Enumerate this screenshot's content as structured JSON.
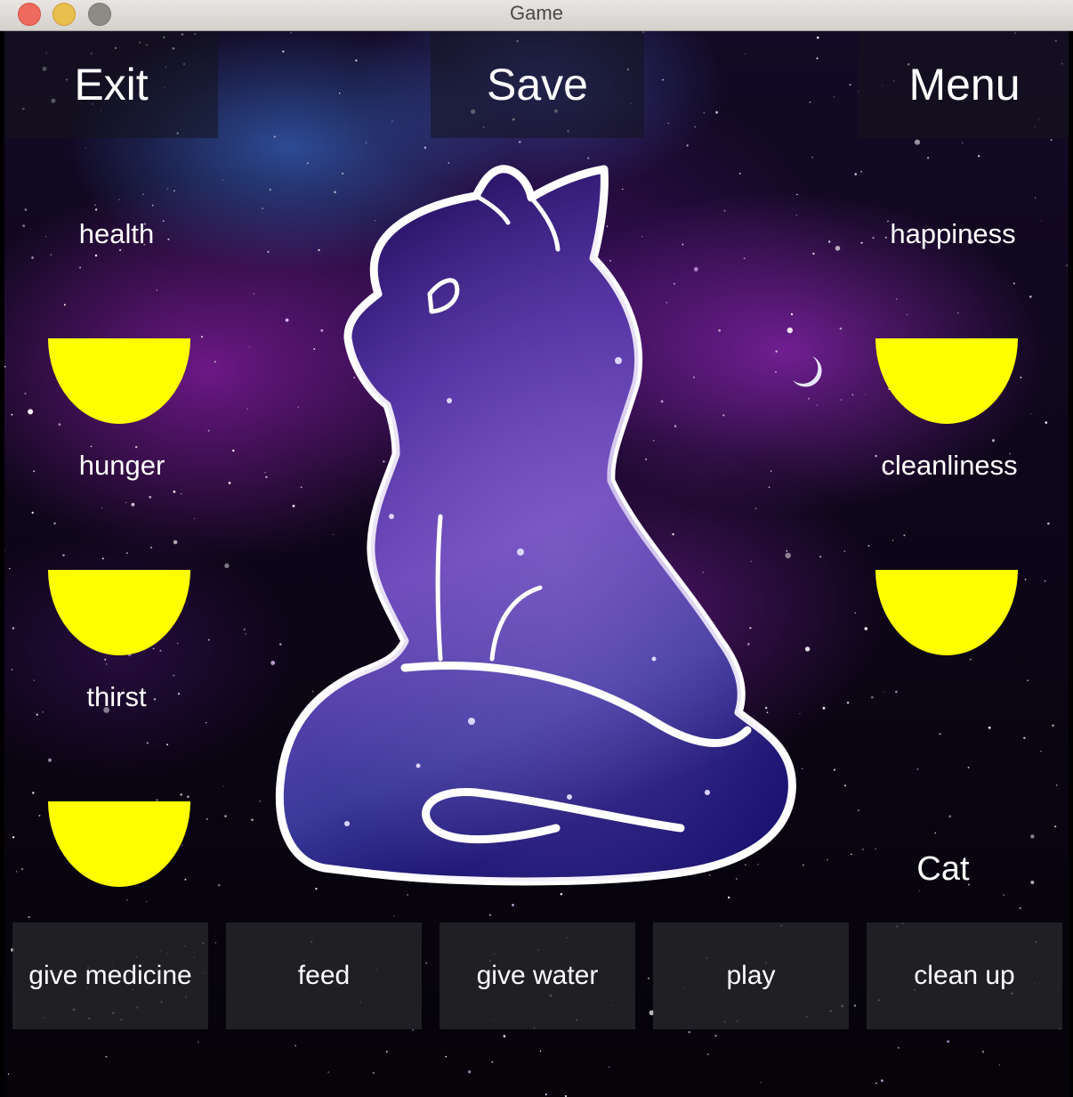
{
  "window": {
    "title": "Game"
  },
  "top_bar": {
    "exit_label": "Exit",
    "save_label": "Save",
    "menu_label": "Menu"
  },
  "stats": {
    "health": {
      "label": "health",
      "level": 0.5
    },
    "hunger": {
      "label": "hunger",
      "level": 0.5
    },
    "thirst": {
      "label": "thirst",
      "level": 0.5
    },
    "happiness": {
      "label": "happiness",
      "level": 0.5
    },
    "cleanliness": {
      "label": "cleanliness",
      "level": 0.5
    }
  },
  "gauge_color": "#ffff00",
  "pet": {
    "name": "Cat",
    "image": "galaxy-cat-illustration"
  },
  "actions": [
    {
      "label": "give medicine"
    },
    {
      "label": "feed"
    },
    {
      "label": "give water"
    },
    {
      "label": "play"
    },
    {
      "label": "clean up"
    }
  ],
  "traffic_lights": [
    "close-icon",
    "minimize-icon",
    "maximize-icon"
  ]
}
